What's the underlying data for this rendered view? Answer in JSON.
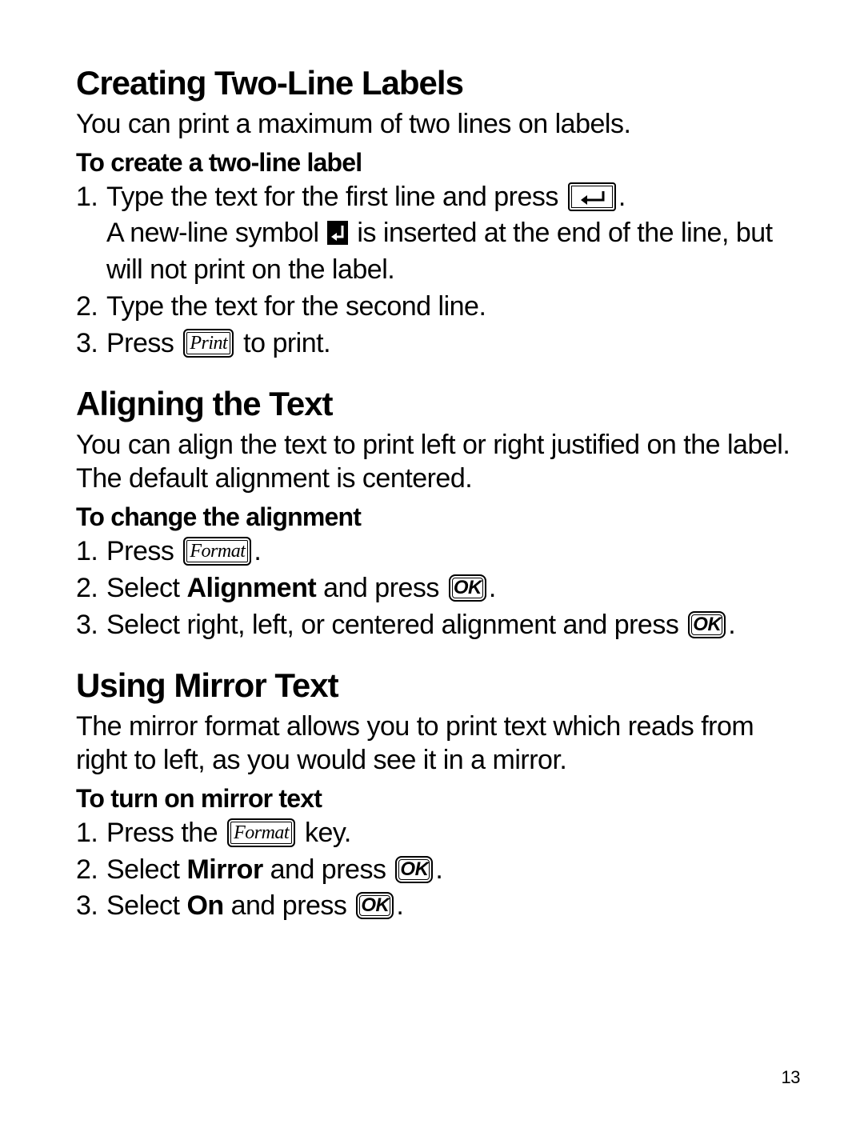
{
  "page_number": "13",
  "s1": {
    "heading": "Creating Two-Line Labels",
    "intro": "You can print a maximum of two lines on labels.",
    "subhead": "To create a two-line label",
    "step1a": "Type the text for the first line and press ",
    "step1b": ".",
    "step1c_a": "A new-line symbol ",
    "step1c_b": " is inserted at the end of the line, but will not print on the label.",
    "step2": "Type the text for the second line.",
    "step3a": "Press ",
    "step3b": " to print."
  },
  "s2": {
    "heading": "Aligning the Text",
    "intro": "You can align the text to print left or right justified on the label. The default alignment is centered.",
    "subhead": "To change the alignment",
    "step1a": "Press ",
    "step1b": ".",
    "step2a": "Select ",
    "step2b": "Alignment",
    "step2c": " and press ",
    "step2d": ".",
    "step3a": "Select right, left, or centered alignment and press ",
    "step3b": "."
  },
  "s3": {
    "heading": "Using Mirror Text",
    "intro": "The mirror format allows you to print text which reads from right to left, as you would see it in a mirror.",
    "subhead": "To turn on mirror text",
    "step1a": "Press the ",
    "step1b": " key.",
    "step2a": "Select ",
    "step2b": "Mirror",
    "step2c": " and press ",
    "step2d": ".",
    "step3a": "Select ",
    "step3b": "On",
    "step3c": " and press ",
    "step3d": "."
  },
  "keys": {
    "print": "Print",
    "format": "Format",
    "ok": "OK"
  }
}
